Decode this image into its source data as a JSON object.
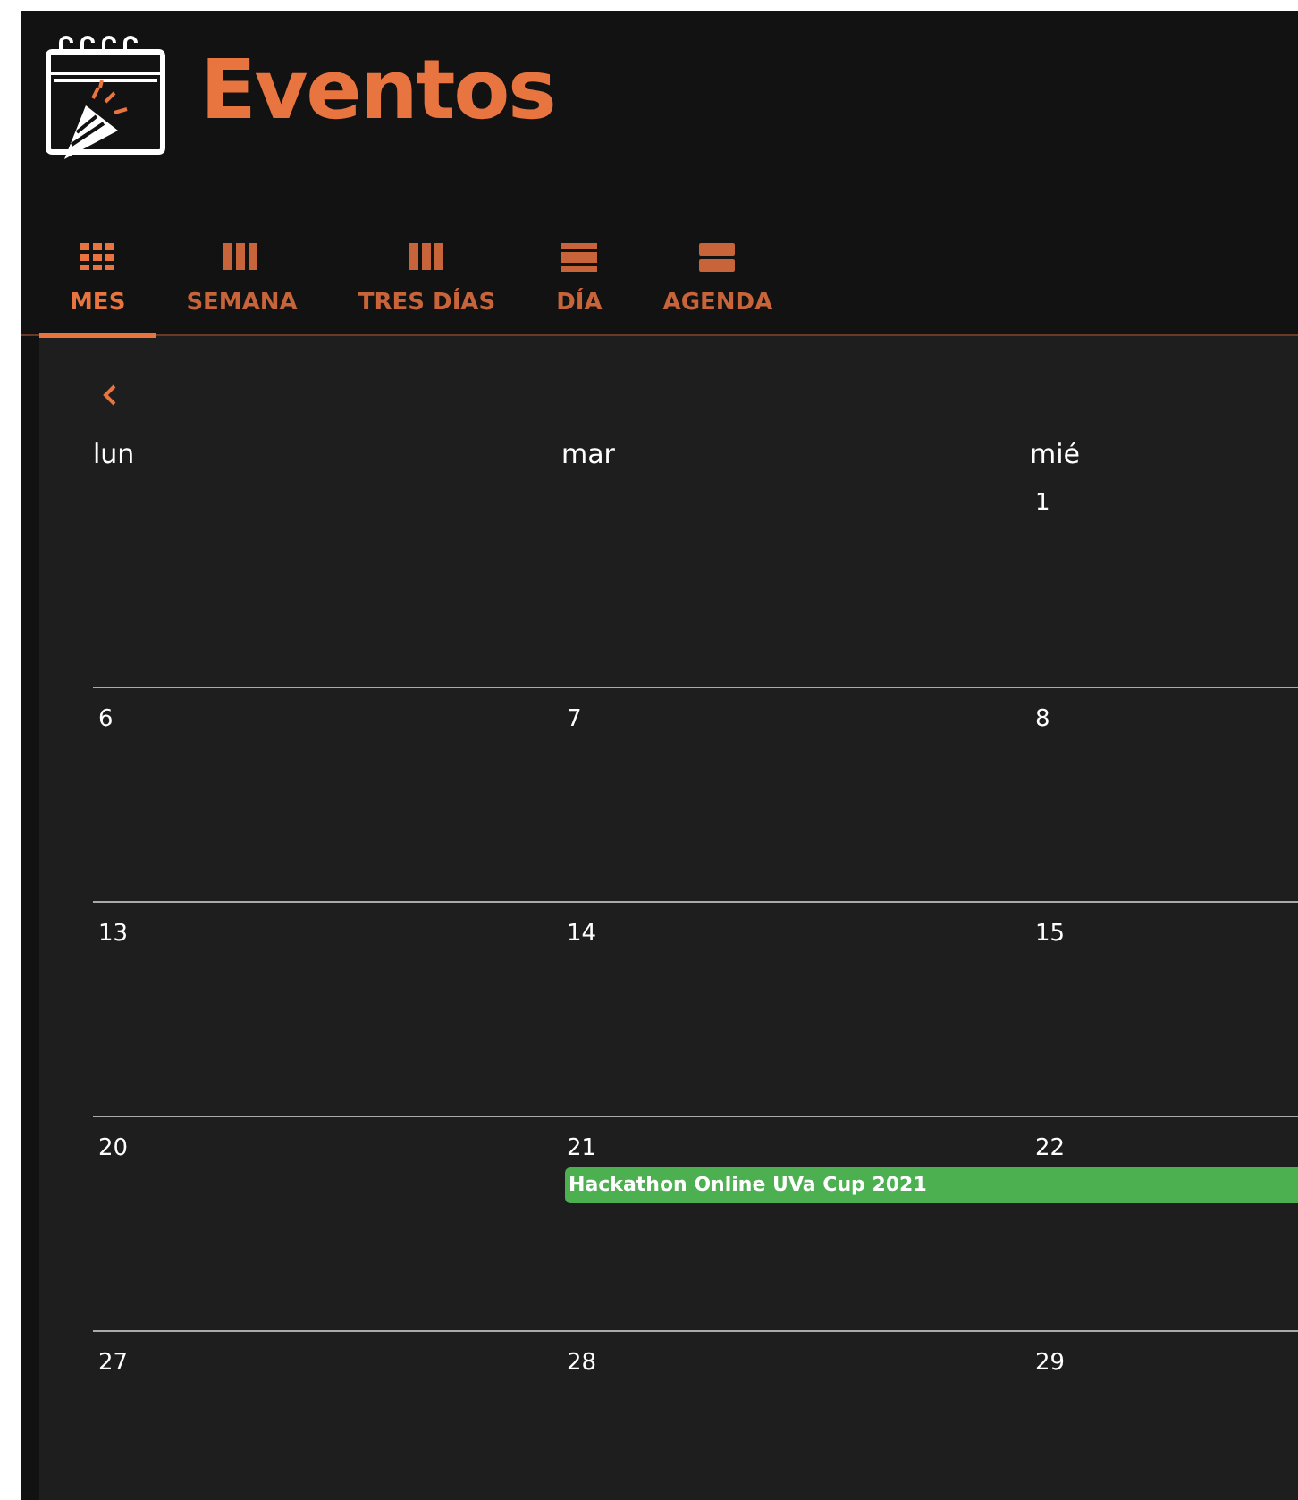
{
  "title": "Eventos",
  "tabs": [
    {
      "label": "MES",
      "selected": true
    },
    {
      "label": "SEMANA",
      "selected": false
    },
    {
      "label": "TRES DÍAS",
      "selected": false
    },
    {
      "label": "DÍA",
      "selected": false
    },
    {
      "label": "AGENDA",
      "selected": false
    }
  ],
  "weekdays": [
    "lun",
    "mar",
    "mié"
  ],
  "weeks": [
    {
      "days": [
        {
          "date": "1"
        }
      ]
    },
    {
      "days": [
        {
          "date": "6"
        },
        {
          "date": "7"
        },
        {
          "date": "8"
        }
      ]
    },
    {
      "days": [
        {
          "date": "13"
        },
        {
          "date": "14"
        },
        {
          "date": "15"
        }
      ]
    },
    {
      "days": [
        {
          "date": "20"
        },
        {
          "date": "21",
          "events": [
            {
              "title": "Hackathon Online UVa Cup 2021",
              "color": "#4caf50"
            }
          ]
        },
        {
          "date": "22"
        }
      ]
    },
    {
      "days": [
        {
          "date": "27"
        },
        {
          "date": "28"
        },
        {
          "date": "29"
        }
      ]
    }
  ]
}
